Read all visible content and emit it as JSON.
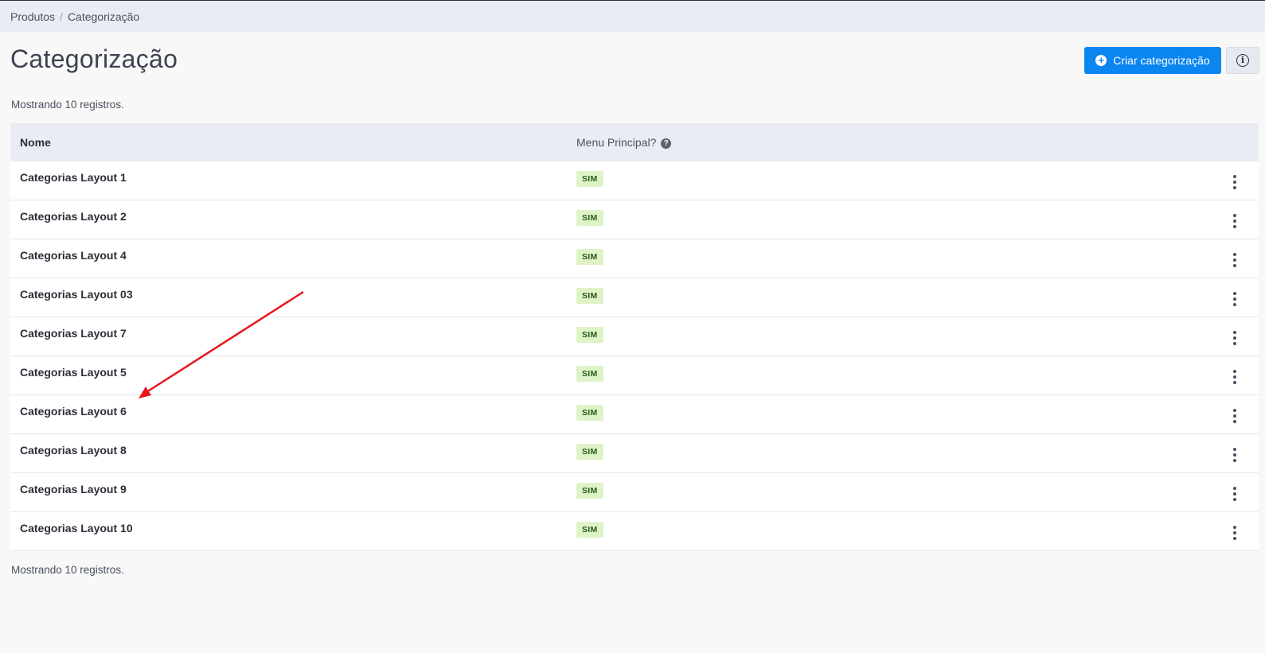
{
  "breadcrumb": {
    "items": [
      "Produtos",
      "Categorização"
    ],
    "separator": "/"
  },
  "header": {
    "title": "Categorização",
    "create_button": "Criar categorização",
    "create_icon": "plus-circle-icon",
    "info_icon": "info-icon"
  },
  "records_count_text": "Mostrando 10 registros.",
  "table": {
    "columns": {
      "name": "Nome",
      "menu": "Menu Principal?"
    },
    "rows": [
      {
        "name": "Categorias Layout 1",
        "menu": "SIM"
      },
      {
        "name": "Categorias Layout 2",
        "menu": "SIM"
      },
      {
        "name": "Categorias Layout 4",
        "menu": "SIM"
      },
      {
        "name": "Categorias Layout 03",
        "menu": "SIM"
      },
      {
        "name": "Categorias Layout 7",
        "menu": "SIM"
      },
      {
        "name": "Categorias Layout 5",
        "menu": "SIM"
      },
      {
        "name": "Categorias Layout 6",
        "menu": "SIM"
      },
      {
        "name": "Categorias Layout 8",
        "menu": "SIM"
      },
      {
        "name": "Categorias Layout 9",
        "menu": "SIM"
      },
      {
        "name": "Categorias Layout 10",
        "menu": "SIM"
      }
    ]
  },
  "colors": {
    "primary": "#0b85f0",
    "badge_bg": "#dff3c9",
    "annotation_arrow": "#e8161b"
  }
}
